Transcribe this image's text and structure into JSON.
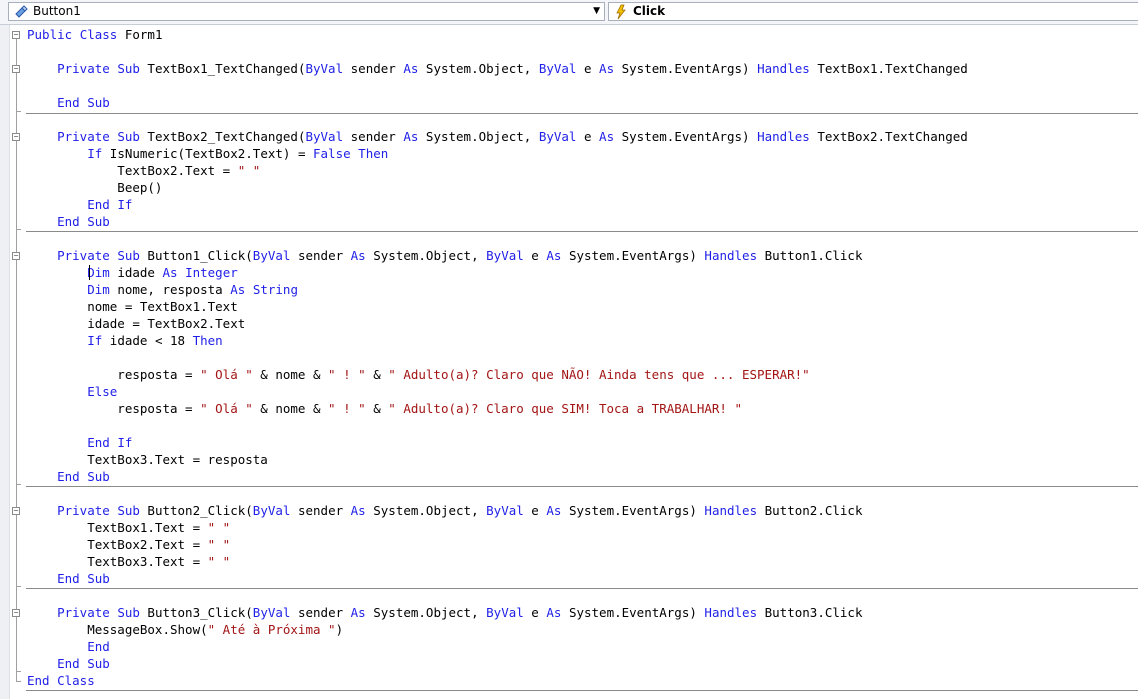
{
  "toolbar": {
    "object_combo": {
      "value": "Button1",
      "icon": "component-icon"
    },
    "event_combo": {
      "value": "Click",
      "icon": "lightning-icon"
    }
  },
  "colors": {
    "keyword": "#1f1fe8",
    "string": "#a31515",
    "text": "#000000"
  },
  "code": {
    "lines": [
      [
        [
          "k",
          "Public"
        ],
        [
          "t",
          " "
        ],
        [
          "k",
          "Class"
        ],
        [
          "t",
          " Form1"
        ]
      ],
      [],
      [
        [
          "t",
          "    "
        ],
        [
          "k",
          "Private"
        ],
        [
          "t",
          " "
        ],
        [
          "k",
          "Sub"
        ],
        [
          "t",
          " TextBox1_TextChanged("
        ],
        [
          "k",
          "ByVal"
        ],
        [
          "t",
          " sender "
        ],
        [
          "k",
          "As"
        ],
        [
          "t",
          " System.Object, "
        ],
        [
          "k",
          "ByVal"
        ],
        [
          "t",
          " e "
        ],
        [
          "k",
          "As"
        ],
        [
          "t",
          " System.EventArgs) "
        ],
        [
          "k",
          "Handles"
        ],
        [
          "t",
          " TextBox1.TextChanged"
        ]
      ],
      [],
      [
        [
          "t",
          "    "
        ],
        [
          "k",
          "End"
        ],
        [
          "t",
          " "
        ],
        [
          "k",
          "Sub"
        ]
      ],
      [],
      [
        [
          "t",
          "    "
        ],
        [
          "k",
          "Private"
        ],
        [
          "t",
          " "
        ],
        [
          "k",
          "Sub"
        ],
        [
          "t",
          " TextBox2_TextChanged("
        ],
        [
          "k",
          "ByVal"
        ],
        [
          "t",
          " sender "
        ],
        [
          "k",
          "As"
        ],
        [
          "t",
          " System.Object, "
        ],
        [
          "k",
          "ByVal"
        ],
        [
          "t",
          " e "
        ],
        [
          "k",
          "As"
        ],
        [
          "t",
          " System.EventArgs) "
        ],
        [
          "k",
          "Handles"
        ],
        [
          "t",
          " TextBox2.TextChanged"
        ]
      ],
      [
        [
          "t",
          "        "
        ],
        [
          "k",
          "If"
        ],
        [
          "t",
          " IsNumeric(TextBox2.Text) = "
        ],
        [
          "k",
          "False"
        ],
        [
          "t",
          " "
        ],
        [
          "k",
          "Then"
        ]
      ],
      [
        [
          "t",
          "            TextBox2.Text = "
        ],
        [
          "s",
          "\" \""
        ]
      ],
      [
        [
          "t",
          "            Beep()"
        ]
      ],
      [
        [
          "t",
          "        "
        ],
        [
          "k",
          "End"
        ],
        [
          "t",
          " "
        ],
        [
          "k",
          "If"
        ]
      ],
      [
        [
          "t",
          "    "
        ],
        [
          "k",
          "End"
        ],
        [
          "t",
          " "
        ],
        [
          "k",
          "Sub"
        ]
      ],
      [],
      [
        [
          "t",
          "    "
        ],
        [
          "k",
          "Private"
        ],
        [
          "t",
          " "
        ],
        [
          "k",
          "Sub"
        ],
        [
          "t",
          " Button1_Click("
        ],
        [
          "k",
          "ByVal"
        ],
        [
          "t",
          " sender "
        ],
        [
          "k",
          "As"
        ],
        [
          "t",
          " System.Object, "
        ],
        [
          "k",
          "ByVal"
        ],
        [
          "t",
          " e "
        ],
        [
          "k",
          "As"
        ],
        [
          "t",
          " System.EventArgs) "
        ],
        [
          "k",
          "Handles"
        ],
        [
          "t",
          " Button1.Click"
        ]
      ],
      [
        [
          "t",
          "        "
        ],
        [
          "k",
          "Dim"
        ],
        [
          "t",
          " idade "
        ],
        [
          "k",
          "As"
        ],
        [
          "t",
          " "
        ],
        [
          "k",
          "Integer"
        ]
      ],
      [
        [
          "t",
          "        "
        ],
        [
          "k",
          "Dim"
        ],
        [
          "t",
          " nome, resposta "
        ],
        [
          "k",
          "As"
        ],
        [
          "t",
          " "
        ],
        [
          "k",
          "String"
        ]
      ],
      [
        [
          "t",
          "        nome = TextBox1.Text"
        ]
      ],
      [
        [
          "t",
          "        idade = TextBox2.Text"
        ]
      ],
      [
        [
          "t",
          "        "
        ],
        [
          "k",
          "If"
        ],
        [
          "t",
          " idade < 18 "
        ],
        [
          "k",
          "Then"
        ]
      ],
      [],
      [
        [
          "t",
          "            resposta = "
        ],
        [
          "s",
          "\" Olá \""
        ],
        [
          "t",
          " & nome & "
        ],
        [
          "s",
          "\" ! \""
        ],
        [
          "t",
          " & "
        ],
        [
          "s",
          "\" Adulto(a)? Claro que NÃO! Ainda tens que ... ESPERAR!\""
        ]
      ],
      [
        [
          "t",
          "        "
        ],
        [
          "k",
          "Else"
        ]
      ],
      [
        [
          "t",
          "            resposta = "
        ],
        [
          "s",
          "\" Olá \""
        ],
        [
          "t",
          " & nome & "
        ],
        [
          "s",
          "\" ! \""
        ],
        [
          "t",
          " & "
        ],
        [
          "s",
          "\" Adulto(a)? Claro que SIM! Toca a TRABALHAR! \""
        ]
      ],
      [],
      [
        [
          "t",
          "        "
        ],
        [
          "k",
          "End"
        ],
        [
          "t",
          " "
        ],
        [
          "k",
          "If"
        ]
      ],
      [
        [
          "t",
          "        TextBox3.Text = resposta"
        ]
      ],
      [
        [
          "t",
          "    "
        ],
        [
          "k",
          "End"
        ],
        [
          "t",
          " "
        ],
        [
          "k",
          "Sub"
        ]
      ],
      [],
      [
        [
          "t",
          "    "
        ],
        [
          "k",
          "Private"
        ],
        [
          "t",
          " "
        ],
        [
          "k",
          "Sub"
        ],
        [
          "t",
          " Button2_Click("
        ],
        [
          "k",
          "ByVal"
        ],
        [
          "t",
          " sender "
        ],
        [
          "k",
          "As"
        ],
        [
          "t",
          " System.Object, "
        ],
        [
          "k",
          "ByVal"
        ],
        [
          "t",
          " e "
        ],
        [
          "k",
          "As"
        ],
        [
          "t",
          " System.EventArgs) "
        ],
        [
          "k",
          "Handles"
        ],
        [
          "t",
          " Button2.Click"
        ]
      ],
      [
        [
          "t",
          "        TextBox1.Text = "
        ],
        [
          "s",
          "\" \""
        ]
      ],
      [
        [
          "t",
          "        TextBox2.Text = "
        ],
        [
          "s",
          "\" \""
        ]
      ],
      [
        [
          "t",
          "        TextBox3.Text = "
        ],
        [
          "s",
          "\" \""
        ]
      ],
      [
        [
          "t",
          "    "
        ],
        [
          "k",
          "End"
        ],
        [
          "t",
          " "
        ],
        [
          "k",
          "Sub"
        ]
      ],
      [],
      [
        [
          "t",
          "    "
        ],
        [
          "k",
          "Private"
        ],
        [
          "t",
          " "
        ],
        [
          "k",
          "Sub"
        ],
        [
          "t",
          " Button3_Click("
        ],
        [
          "k",
          "ByVal"
        ],
        [
          "t",
          " sender "
        ],
        [
          "k",
          "As"
        ],
        [
          "t",
          " System.Object, "
        ],
        [
          "k",
          "ByVal"
        ],
        [
          "t",
          " e "
        ],
        [
          "k",
          "As"
        ],
        [
          "t",
          " System.EventArgs) "
        ],
        [
          "k",
          "Handles"
        ],
        [
          "t",
          " Button3.Click"
        ]
      ],
      [
        [
          "t",
          "        MessageBox.Show("
        ],
        [
          "s",
          "\" Até à Próxima \""
        ],
        [
          "t",
          ")"
        ]
      ],
      [
        [
          "t",
          "        "
        ],
        [
          "k",
          "End"
        ]
      ],
      [
        [
          "t",
          "    "
        ],
        [
          "k",
          "End"
        ],
        [
          "t",
          " "
        ],
        [
          "k",
          "Sub"
        ]
      ],
      [
        [
          "k",
          "End"
        ],
        [
          "t",
          " "
        ],
        [
          "k",
          "Class"
        ]
      ]
    ]
  }
}
